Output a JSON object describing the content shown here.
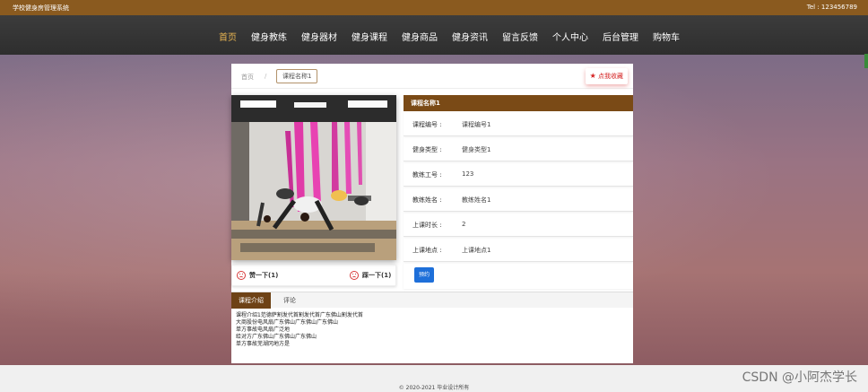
{
  "header": {
    "site_name": "学校健身房管理系统",
    "tel": "Tel : 123456789"
  },
  "nav": {
    "items": [
      "首页",
      "健身教练",
      "健身器材",
      "健身课程",
      "健身商品",
      "健身资讯",
      "留言反馈",
      "个人中心",
      "后台管理",
      "购物车"
    ],
    "active_index": 0
  },
  "breadcrumb": {
    "home": "首页",
    "separator": "/",
    "current": "课程名称1"
  },
  "favorite": {
    "label": "点我收藏",
    "icon": "star-icon"
  },
  "course": {
    "title": "课程名称1",
    "fields": [
      {
        "label": "课程编号 :",
        "value": "课程编号1"
      },
      {
        "label": "健身类型 :",
        "value": "健身类型1"
      },
      {
        "label": "教练工号 :",
        "value": "123"
      },
      {
        "label": "教练姓名 :",
        "value": "教练姓名1"
      },
      {
        "label": "上课时长 :",
        "value": "2"
      },
      {
        "label": "上课地点 :",
        "value": "上课地点1"
      }
    ],
    "book_button": "预约"
  },
  "votes": {
    "up_label": "赞一下(1)",
    "down_label": "踩一下(1)"
  },
  "tabs": {
    "intro": "课程介绍",
    "comments": "评论"
  },
  "intro_lines": [
    "课程介绍1范德萨割发代首割发代首广东佛山割发代首",
    "大商股份电风扇广东佛山广东佛山广东佛山",
    "单方事故电风扇广泛地",
    "给对方广东佛山广东佛山广东佛山",
    "单方事故芜湖冈地方是"
  ],
  "footer": {
    "copyright": "© 2020-2021 毕业设计所有"
  },
  "watermark": "CSDN @小阿杰学长",
  "colors": {
    "topbar": "#8a5a1f",
    "navbar": "#333333",
    "nav_active": "#e8b552",
    "accent_brown": "#7a4a16",
    "button_blue": "#1e6fd9",
    "favorite_red": "#d42121"
  }
}
